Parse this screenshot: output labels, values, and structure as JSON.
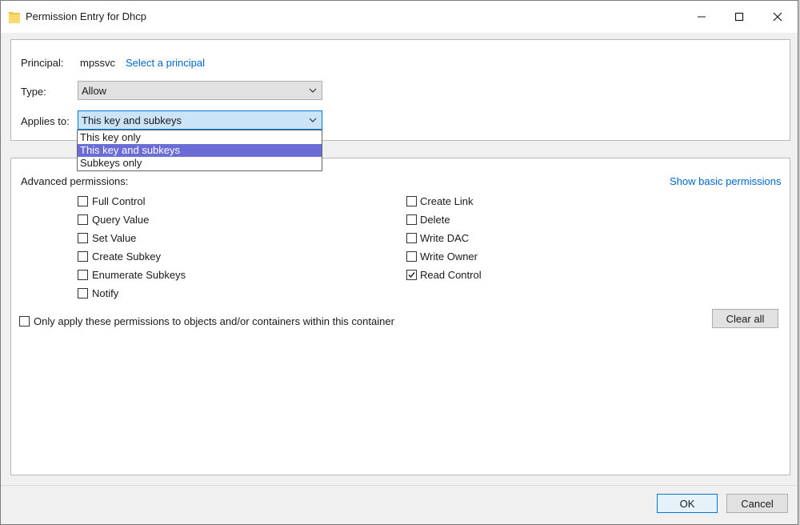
{
  "window": {
    "title": "Permission Entry for Dhcp"
  },
  "principal": {
    "label": "Principal:",
    "value": "mpssvc",
    "link": "Select a principal"
  },
  "type": {
    "label": "Type:",
    "value": "Allow"
  },
  "applies_to": {
    "label": "Applies to:",
    "value": "This key and subkeys",
    "options": [
      "This key only",
      "This key and subkeys",
      "Subkeys only"
    ],
    "selected_index": 1
  },
  "advanced": {
    "label": "Advanced permissions:",
    "show_basic_link": "Show basic permissions",
    "left": [
      {
        "label": "Full Control",
        "checked": false
      },
      {
        "label": "Query Value",
        "checked": false
      },
      {
        "label": "Set Value",
        "checked": false
      },
      {
        "label": "Create Subkey",
        "checked": false
      },
      {
        "label": "Enumerate Subkeys",
        "checked": false
      },
      {
        "label": "Notify",
        "checked": false
      }
    ],
    "right": [
      {
        "label": "Create Link",
        "checked": false
      },
      {
        "label": "Delete",
        "checked": false
      },
      {
        "label": "Write DAC",
        "checked": false
      },
      {
        "label": "Write Owner",
        "checked": false
      },
      {
        "label": "Read Control",
        "checked": true
      }
    ]
  },
  "only_apply": {
    "label": "Only apply these permissions to objects and/or containers within this container",
    "checked": false
  },
  "buttons": {
    "clear_all": "Clear all",
    "ok": "OK",
    "cancel": "Cancel"
  },
  "icons": {
    "title": "folder-icon",
    "minimize": "minimize-icon",
    "maximize": "maximize-icon",
    "close": "close-icon",
    "dropdown": "chevron-down-icon",
    "check": "checkmark-icon"
  }
}
